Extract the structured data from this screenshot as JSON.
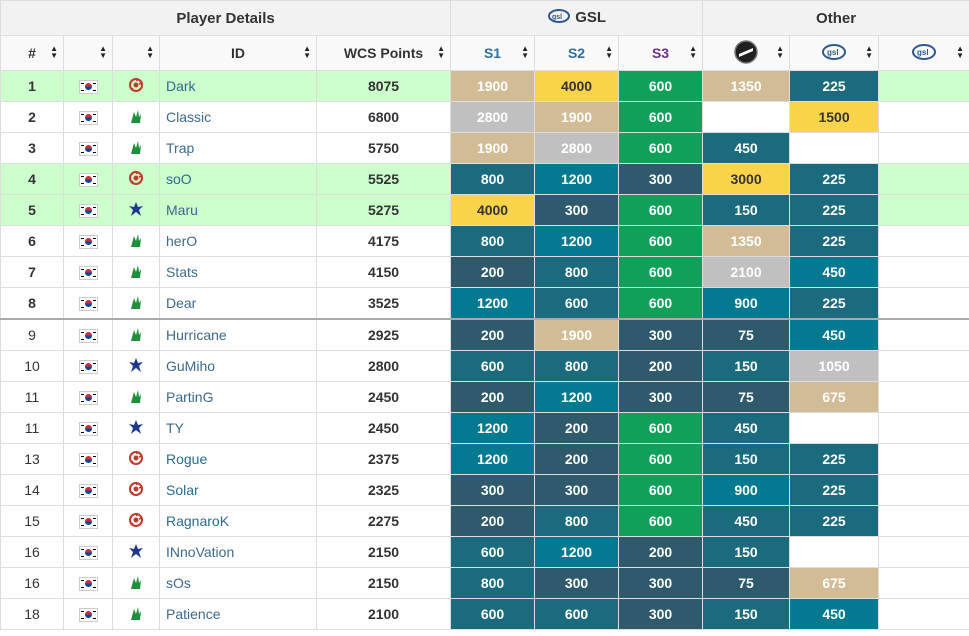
{
  "groups": {
    "player_details": "Player Details",
    "gsl": "GSL",
    "other": "Other"
  },
  "headers": {
    "rank": "#",
    "id": "ID",
    "wcs_points": "WCS Points",
    "s1": "S1",
    "s2": "S2",
    "s3": "S3"
  },
  "header_icons": [
    "wcs-logo-icon",
    "gsl-logo-icon",
    "gsl-logo-icon"
  ],
  "colors": {
    "gold": "#f9d44a",
    "silver": "#c0c0c0",
    "bronze": "#d2bc96",
    "dark": "#2e5a6b",
    "teal": "#037a8f",
    "darkteal": "#1b6a7e",
    "green": "#11a05a",
    "highlight": "#ccffcc",
    "s1_label": "#2e6ea0",
    "s2_label": "#2e6ea0",
    "s3_label": "#6a2e8c"
  },
  "rows": [
    {
      "rank": "1",
      "bold": true,
      "hl": true,
      "race": "zerg",
      "id": "Dark",
      "pts": "8075",
      "s1": "1900",
      "s2": "4000",
      "s3": "600",
      "o1": "1350",
      "o2": "225",
      "o3": ""
    },
    {
      "rank": "2",
      "bold": true,
      "hl": false,
      "race": "protoss",
      "id": "Classic",
      "pts": "6800",
      "s1": "2800",
      "s2": "1900",
      "s3": "600",
      "o1": "",
      "o2": "1500",
      "o3": ""
    },
    {
      "rank": "3",
      "bold": true,
      "hl": false,
      "race": "protoss",
      "id": "Trap",
      "pts": "5750",
      "s1": "1900",
      "s2": "2800",
      "s3": "600",
      "o1": "450",
      "o2": "",
      "o3": ""
    },
    {
      "rank": "4",
      "bold": true,
      "hl": true,
      "race": "zerg",
      "id": "soO",
      "pts": "5525",
      "s1": "800",
      "s2": "1200",
      "s3": "300",
      "o1": "3000",
      "o2": "225",
      "o3": ""
    },
    {
      "rank": "5",
      "bold": true,
      "hl": true,
      "race": "terran",
      "id": "Maru",
      "pts": "5275",
      "s1": "4000",
      "s2": "300",
      "s3": "600",
      "o1": "150",
      "o2": "225",
      "o3": ""
    },
    {
      "rank": "6",
      "bold": true,
      "hl": false,
      "race": "protoss",
      "id": "herO",
      "pts": "4175",
      "s1": "800",
      "s2": "1200",
      "s3": "600",
      "o1": "1350",
      "o2": "225",
      "o3": ""
    },
    {
      "rank": "7",
      "bold": true,
      "hl": false,
      "race": "protoss",
      "id": "Stats",
      "pts": "4150",
      "s1": "200",
      "s2": "800",
      "s3": "600",
      "o1": "2100",
      "o2": "450",
      "o3": ""
    },
    {
      "rank": "8",
      "bold": true,
      "hl": false,
      "race": "protoss",
      "id": "Dear",
      "pts": "3525",
      "s1": "1200",
      "s2": "600",
      "s3": "600",
      "o1": "900",
      "o2": "225",
      "o3": ""
    },
    {
      "rank": "9",
      "bold": false,
      "hl": false,
      "race": "protoss",
      "id": "Hurricane",
      "pts": "2925",
      "s1": "200",
      "s2": "1900",
      "s3": "300",
      "o1": "75",
      "o2": "450",
      "o3": ""
    },
    {
      "rank": "10",
      "bold": false,
      "hl": false,
      "race": "terran",
      "id": "GuMiho",
      "pts": "2800",
      "s1": "600",
      "s2": "800",
      "s3": "200",
      "o1": "150",
      "o2": "1050",
      "o3": ""
    },
    {
      "rank": "11",
      "bold": false,
      "hl": false,
      "race": "protoss",
      "id": "PartinG",
      "pts": "2450",
      "s1": "200",
      "s2": "1200",
      "s3": "300",
      "o1": "75",
      "o2": "675",
      "o3": ""
    },
    {
      "rank": "11",
      "bold": false,
      "hl": false,
      "race": "terran",
      "id": "TY",
      "pts": "2450",
      "s1": "1200",
      "s2": "200",
      "s3": "600",
      "o1": "450",
      "o2": "",
      "o3": ""
    },
    {
      "rank": "13",
      "bold": false,
      "hl": false,
      "race": "zerg",
      "id": "Rogue",
      "pts": "2375",
      "s1": "1200",
      "s2": "200",
      "s3": "600",
      "o1": "150",
      "o2": "225",
      "o3": ""
    },
    {
      "rank": "14",
      "bold": false,
      "hl": false,
      "race": "zerg",
      "id": "Solar",
      "pts": "2325",
      "s1": "300",
      "s2": "300",
      "s3": "600",
      "o1": "900",
      "o2": "225",
      "o3": ""
    },
    {
      "rank": "15",
      "bold": false,
      "hl": false,
      "race": "zerg",
      "id": "RagnaroK",
      "pts": "2275",
      "s1": "200",
      "s2": "800",
      "s3": "600",
      "o1": "450",
      "o2": "225",
      "o3": ""
    },
    {
      "rank": "16",
      "bold": false,
      "hl": false,
      "race": "terran",
      "id": "INnoVation",
      "pts": "2150",
      "s1": "600",
      "s2": "1200",
      "s3": "200",
      "o1": "150",
      "o2": "",
      "o3": ""
    },
    {
      "rank": "16",
      "bold": false,
      "hl": false,
      "race": "protoss",
      "id": "sOs",
      "pts": "2150",
      "s1": "800",
      "s2": "300",
      "s3": "300",
      "o1": "75",
      "o2": "675",
      "o3": ""
    },
    {
      "rank": "18",
      "bold": false,
      "hl": false,
      "race": "protoss",
      "id": "Patience",
      "pts": "2100",
      "s1": "600",
      "s2": "600",
      "s3": "300",
      "o1": "150",
      "o2": "450",
      "o3": ""
    }
  ],
  "cell_colors": [
    [
      "bronze",
      "gold",
      "green",
      "bronze",
      "darkteal",
      "none"
    ],
    [
      "silver",
      "bronze",
      "green",
      "none",
      "gold",
      "none"
    ],
    [
      "bronze",
      "silver",
      "green",
      "darkteal",
      "none",
      "none"
    ],
    [
      "darkteal",
      "teal",
      "dark",
      "gold",
      "darkteal",
      "none"
    ],
    [
      "gold",
      "dark",
      "green",
      "darkteal",
      "darkteal",
      "none"
    ],
    [
      "darkteal",
      "teal",
      "green",
      "bronze",
      "darkteal",
      "none"
    ],
    [
      "dark",
      "darkteal",
      "green",
      "silver",
      "teal",
      "none"
    ],
    [
      "teal",
      "darkteal",
      "green",
      "teal",
      "darkteal",
      "none"
    ],
    [
      "dark",
      "bronze",
      "dark",
      "dark",
      "teal",
      "none"
    ],
    [
      "darkteal",
      "darkteal",
      "dark",
      "darkteal",
      "silver",
      "none"
    ],
    [
      "dark",
      "teal",
      "dark",
      "dark",
      "bronze",
      "none"
    ],
    [
      "teal",
      "dark",
      "green",
      "darkteal",
      "none",
      "none"
    ],
    [
      "teal",
      "dark",
      "green",
      "darkteal",
      "darkteal",
      "none"
    ],
    [
      "dark",
      "dark",
      "green",
      "teal",
      "darkteal",
      "none"
    ],
    [
      "dark",
      "darkteal",
      "green",
      "darkteal",
      "darkteal",
      "none"
    ],
    [
      "darkteal",
      "teal",
      "dark",
      "darkteal",
      "none",
      "none"
    ],
    [
      "darkteal",
      "dark",
      "dark",
      "dark",
      "bronze",
      "none"
    ],
    [
      "darkteal",
      "darkteal",
      "dark",
      "darkteal",
      "teal",
      "none"
    ]
  ]
}
